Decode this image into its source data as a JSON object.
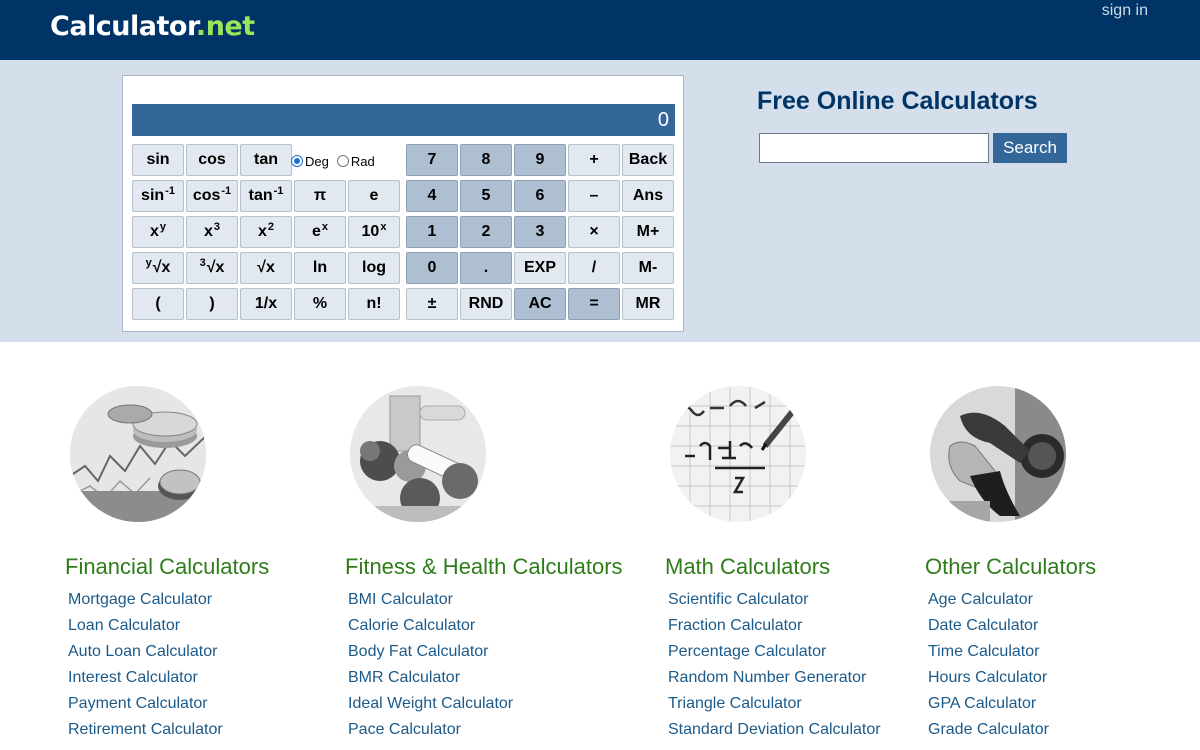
{
  "header": {
    "logo_main": "Calculator",
    "logo_dot": ".",
    "logo_net": "net",
    "signin": "sign in"
  },
  "calculator": {
    "display": "0",
    "angle_modes": [
      "Deg",
      "Rad"
    ],
    "selected_mode": "Deg"
  },
  "search": {
    "title": "Free Online Calculators",
    "placeholder": "",
    "button": "Search"
  },
  "categories": [
    {
      "title": "Financial Calculators",
      "icon": "finance-coins-chart-image",
      "links": [
        "Mortgage Calculator",
        "Loan Calculator",
        "Auto Loan Calculator",
        "Interest Calculator",
        "Payment Calculator",
        "Retirement Calculator"
      ]
    },
    {
      "title": "Fitness & Health Calculators",
      "icon": "fitness-food-tape-image",
      "links": [
        "BMI Calculator",
        "Calorie Calculator",
        "Body Fat Calculator",
        "BMR Calculator",
        "Ideal Weight Calculator",
        "Pace Calculator"
      ]
    },
    {
      "title": "Math Calculators",
      "icon": "math-equation-paper-image",
      "links": [
        "Scientific Calculator",
        "Fraction Calculator",
        "Percentage Calculator",
        "Random Number Generator",
        "Triangle Calculator",
        "Standard Deviation Calculator"
      ]
    },
    {
      "title": "Other Calculators",
      "icon": "fuel-pump-nozzle-image",
      "links": [
        "Age Calculator",
        "Date Calculator",
        "Time Calculator",
        "Hours Calculator",
        "GPA Calculator",
        "Grade Calculator"
      ]
    }
  ],
  "keys": {
    "sin": "sin",
    "cos": "cos",
    "tan": "tan",
    "asin": "sin",
    "acos": "cos",
    "atan": "tan",
    "inv_exp": "-1",
    "pi": "π",
    "e": "e",
    "xy_base": "x",
    "xy_exp": "y",
    "x3_base": "x",
    "x3_exp": "3",
    "x2_base": "x",
    "x2_exp": "2",
    "ex_base": "e",
    "ex_exp": "x",
    "tenx_base": "10",
    "tenx_exp": "x",
    "yroot_pre": "y",
    "yroot_main": "√x",
    "cuberoot_pre": "3",
    "cuberoot_main": "√x",
    "sqrt": "√x",
    "ln": "ln",
    "log": "log",
    "lparen": "(",
    "rparen": ")",
    "recip": "1/x",
    "percent": "%",
    "fact": "n!",
    "d7": "7",
    "d8": "8",
    "d9": "9",
    "plus": "+",
    "back": "Back",
    "d4": "4",
    "d5": "5",
    "d6": "6",
    "minus": "–",
    "ans": "Ans",
    "d1": "1",
    "d2": "2",
    "d3": "3",
    "times": "×",
    "mplus": "M+",
    "d0": "0",
    "dot": ".",
    "exp": "EXP",
    "divide": "/",
    "mminus": "M-",
    "plusminus": "±",
    "rnd": "RND",
    "ac": "AC",
    "equals": "=",
    "mr": "MR"
  }
}
